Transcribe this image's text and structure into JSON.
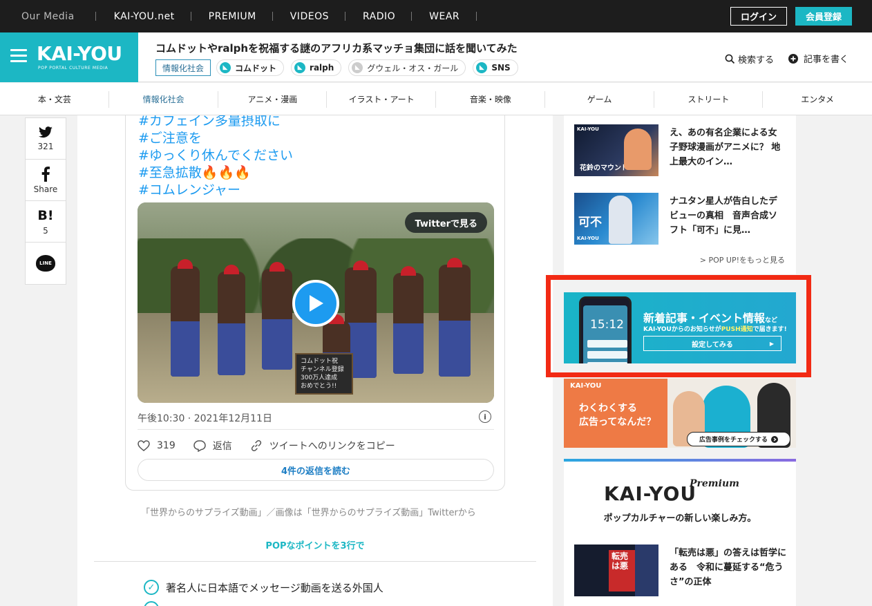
{
  "topnav": {
    "items": [
      "Our Media",
      "KAI-YOU.net",
      "PREMIUM",
      "VIDEOS",
      "RADIO",
      "WEAR"
    ],
    "login": "ログイン",
    "register": "会員登録"
  },
  "header": {
    "logo": "KAI-YOU",
    "logo_sub": "POP PORTAL CULTURE MEDIA",
    "article_title": "コムドットやralphを祝福する謎のアフリカ系マッチョ集団に話を聞いてみた",
    "primary_tag": "情報化社会",
    "tags": [
      "コムドット",
      "ralph",
      "グウェル・オス・ガール",
      "SNS"
    ],
    "search": "検索する",
    "write": "記事を書く"
  },
  "categories": [
    "本・文芸",
    "情報化社会",
    "アニメ・漫画",
    "イラスト・アート",
    "音楽・映像",
    "ゲーム",
    "ストリート",
    "エンタメ"
  ],
  "share": {
    "twitter_count": "321",
    "facebook_label": "Share",
    "hatena_count": "5",
    "hatena_icon": "B!",
    "line_label": "LINE"
  },
  "tweet": {
    "hashtags": [
      "#カフェイン多量摂取に",
      "#ご注意を",
      "#ゆっくり休んでください",
      "#至急拡散🔥🔥🔥",
      "#コムレンジャー"
    ],
    "view_on_twitter": "Twitterで見る",
    "sign_text": [
      "コムドット祝",
      "チャンネル登録",
      "300万人達成",
      "おめでとう!!"
    ],
    "timestamp": "午後10:30 · 2021年12月11日",
    "info_icon": "i",
    "likes": "319",
    "reply_label": "返信",
    "copy_link_label": "ツイートへのリンクをコピー",
    "read_replies": "4件の返信を読む"
  },
  "caption": "「世界からのサプライズ動画」／画像は「世界からのサプライズ動画」Twitterから",
  "pop_points": {
    "heading": "POPなポイントを3行で",
    "items": [
      "著名人に日本語でメッセージ動画を送る外国人"
    ]
  },
  "sidebar": {
    "popup_items": [
      {
        "title": "え、あの有名企業による女子野球漫画がアニメに？ 地上最大のイン…",
        "thumb_label": "KAI-YOU",
        "thumb_text": "花鈴のマウンド"
      },
      {
        "title": "ナユタン星人が告白したデビューの真相　音声合成ソフト「可不」に見…",
        "thumb_label": "KAI-YOU",
        "thumb_text": "可不"
      }
    ],
    "more_link": "> POP UP!をもっと見る",
    "push_banner": {
      "phone_time": "15:12",
      "title": "新着記事・イベント情報",
      "title_suffix": "など",
      "sub_prefix": "KAI-YOUからのお知らせが",
      "sub_highlight": "PUSH通知",
      "sub_suffix": "で届きます!",
      "button": "設定してみる",
      "button_arrow": "▶"
    },
    "ad": {
      "logo": "KAI-YOU",
      "line1": "わくわくする",
      "line2": "広告ってなんだ？",
      "cta": "広告事例をチェックする"
    },
    "premium": {
      "logo": "KAI-YOU",
      "script": "Premium",
      "tagline": "ポップカルチャーの新しい楽しみ方。",
      "item_title": "「転売は悪」の答えは哲学にある　令和に蔓延する“危うさ”の正体",
      "item_thumb_text": "転売は悪"
    }
  },
  "colors": {
    "brand": "#1cb7c4",
    "topbar": "#1d1d1d",
    "twitter_blue": "#1d9bf0",
    "highlight_red": "#f22a14"
  }
}
